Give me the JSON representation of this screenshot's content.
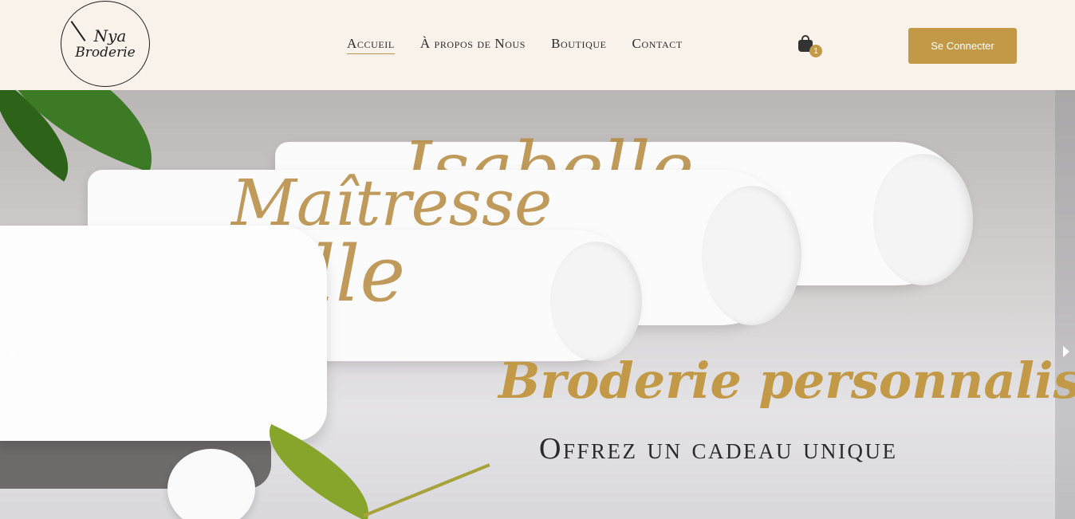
{
  "brand": {
    "logo_line1": "Nya",
    "logo_line2": "Broderie"
  },
  "nav": {
    "items": [
      {
        "label": "Accueil",
        "active": true
      },
      {
        "label": "À propos de Nous",
        "active": false
      },
      {
        "label": "Boutique",
        "active": false
      },
      {
        "label": "Contact",
        "active": false
      }
    ]
  },
  "cart": {
    "icon": "shopping-bag-icon",
    "count": "1"
  },
  "login": {
    "label": "Se Connecter"
  },
  "hero": {
    "title": "Broderie personnalisée",
    "subtitle": "Offrez un cadeau unique",
    "towel_text_1": "Isabelle",
    "towel_text_2": "Maîtresse",
    "towel_text_3": "lle"
  },
  "colors": {
    "accent": "#c29a47",
    "header_bg": "#f8f2ea",
    "text_dark": "#2b2b2b"
  },
  "slider": {
    "prev_icon": "chevron-left-icon",
    "next_icon": "chevron-right-icon"
  }
}
